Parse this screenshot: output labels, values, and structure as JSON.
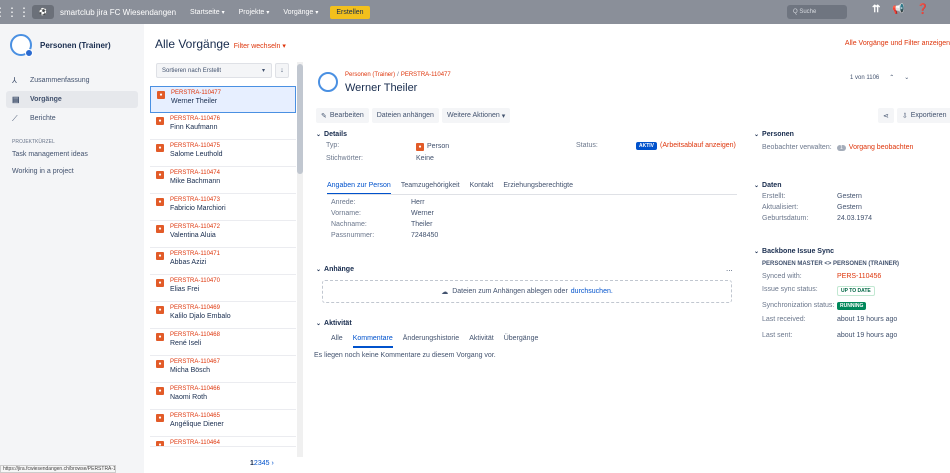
{
  "topbar": {
    "site_name": "smartclub jira FC Wiesendangen",
    "nav": [
      {
        "label": "Startseite"
      },
      {
        "label": "Projekte"
      },
      {
        "label": "Vorgänge"
      }
    ],
    "create_label": "Erstellen",
    "search_placeholder": "Q  Suche",
    "icons": [
      "apps-grid-icon",
      "notifications-icon",
      "feedback-icon",
      "help-icon"
    ]
  },
  "sidebar": {
    "project_name": "Personen (Trainer)",
    "items": [
      {
        "label": "Zusammenfassung",
        "icon": "summary-icon",
        "glyph": "⅄"
      },
      {
        "label": "Vorgänge",
        "icon": "issues-icon",
        "glyph": "▤"
      },
      {
        "label": "Berichte",
        "icon": "reports-icon",
        "glyph": "⟋"
      }
    ],
    "shortcuts_heading": "PROJEKTKÜRZEL",
    "shortcuts": [
      {
        "label": "Task management ideas"
      },
      {
        "label": "Working in a project"
      }
    ]
  },
  "list": {
    "title": "Alle Vorgänge",
    "filter_label": "Filter wechseln",
    "sort_label": "Sortieren nach Erstellt",
    "sort_direction": "↓",
    "rows": [
      {
        "key": "PERSTRA-110477",
        "name": "Werner Theiler"
      },
      {
        "key": "PERSTRA-110476",
        "name": "Finn Kaufmann"
      },
      {
        "key": "PERSTRA-110475",
        "name": "Salome Leuthold"
      },
      {
        "key": "PERSTRA-110474",
        "name": "Mike Bachmann"
      },
      {
        "key": "PERSTRA-110473",
        "name": "Fabricio Marchiori"
      },
      {
        "key": "PERSTRA-110472",
        "name": "Valentina Aluia"
      },
      {
        "key": "PERSTRA-110471",
        "name": "Abbas Azizi"
      },
      {
        "key": "PERSTRA-110470",
        "name": "Elias Frei"
      },
      {
        "key": "PERSTRA-110469",
        "name": "Kalilo Djalo Embalo"
      },
      {
        "key": "PERSTRA-110468",
        "name": "René Iseli"
      },
      {
        "key": "PERSTRA-110467",
        "name": "Micha Bösch"
      },
      {
        "key": "PERSTRA-110466",
        "name": "Naomi Roth"
      },
      {
        "key": "PERSTRA-110465",
        "name": "Angélique Diener"
      },
      {
        "key": "PERSTRA-110464",
        "name": ""
      }
    ],
    "pages": [
      "1",
      "2",
      "3",
      "4",
      "5",
      "›"
    ],
    "status_url": "https://jira.fcwiesendangen.ch/browse/PERSTRA-110477"
  },
  "top_right_link": "Alle Vorgänge und Filter anzeigen",
  "issue": {
    "breadcrumb_project": "Personen (Trainer)",
    "breadcrumb_key": "PERSTRA-110477",
    "title": "Werner Theiler",
    "counter": "1 von 1106",
    "buttons": {
      "edit": "Bearbeiten",
      "attach": "Dateien anhängen",
      "more": "Weitere Aktionen",
      "export": "Exportieren"
    },
    "details_heading": "Details",
    "type_label": "Typ:",
    "type_value": "Person",
    "keywords_label": "Stichwörter:",
    "keywords_value": "Keine",
    "status_label": "Status:",
    "status_value": "AKTIV",
    "workflow_link": "(Arbeitsablauf anzeigen)",
    "tabs": [
      {
        "label": "Angaben zur Person"
      },
      {
        "label": "Teamzugehörigkeit"
      },
      {
        "label": "Kontakt"
      },
      {
        "label": "Erziehungsberechtigte"
      }
    ],
    "person_fields": [
      {
        "label": "Anrede:",
        "value": "Herr"
      },
      {
        "label": "Vorname:",
        "value": "Werner"
      },
      {
        "label": "Nachname:",
        "value": "Theiler"
      },
      {
        "label": "Passnummer:",
        "value": "7248450"
      }
    ],
    "attachments_heading": "Anhänge",
    "attachments_more": "...",
    "drop_text": "Dateien zum Anhängen ablegen oder",
    "browse_link": "durchsuchen.",
    "activity_heading": "Aktivität",
    "activity_tabs": [
      {
        "label": "Alle"
      },
      {
        "label": "Kommentare"
      },
      {
        "label": "Änderungshistorie"
      },
      {
        "label": "Aktivität"
      },
      {
        "label": "Übergänge"
      }
    ],
    "no_comments": "Es liegen noch keine Kommentare zu diesem Vorgang vor.",
    "people_heading": "Personen",
    "watchers_label": "Beobachter verwalten:",
    "watchers_count": "1",
    "watch_link": "Vorgang beobachten",
    "dates_heading": "Daten",
    "dates": [
      {
        "label": "Erstellt:",
        "value": "Gestern"
      },
      {
        "label": "Aktualisiert:",
        "value": "Gestern"
      },
      {
        "label": "Geburtsdatum:",
        "value": "24.03.1974"
      }
    ],
    "sync_heading": "Backbone Issue Sync",
    "sync_title": "PERSONEN MASTER <> PERSONEN (TRAINER)",
    "synced_with_label": "Synced with:",
    "synced_with_value": "PERS-110456",
    "issue_sync_label": "Issue sync status:",
    "issue_sync_value": "UP TO DATE",
    "sync_status_label": "Synchronization status:",
    "sync_status_value": "RUNNING",
    "last_received_label": "Last received:",
    "last_received_value": "about 19 hours ago",
    "last_sent_label": "Last sent:",
    "last_sent_value": "about 19 hours ago"
  }
}
